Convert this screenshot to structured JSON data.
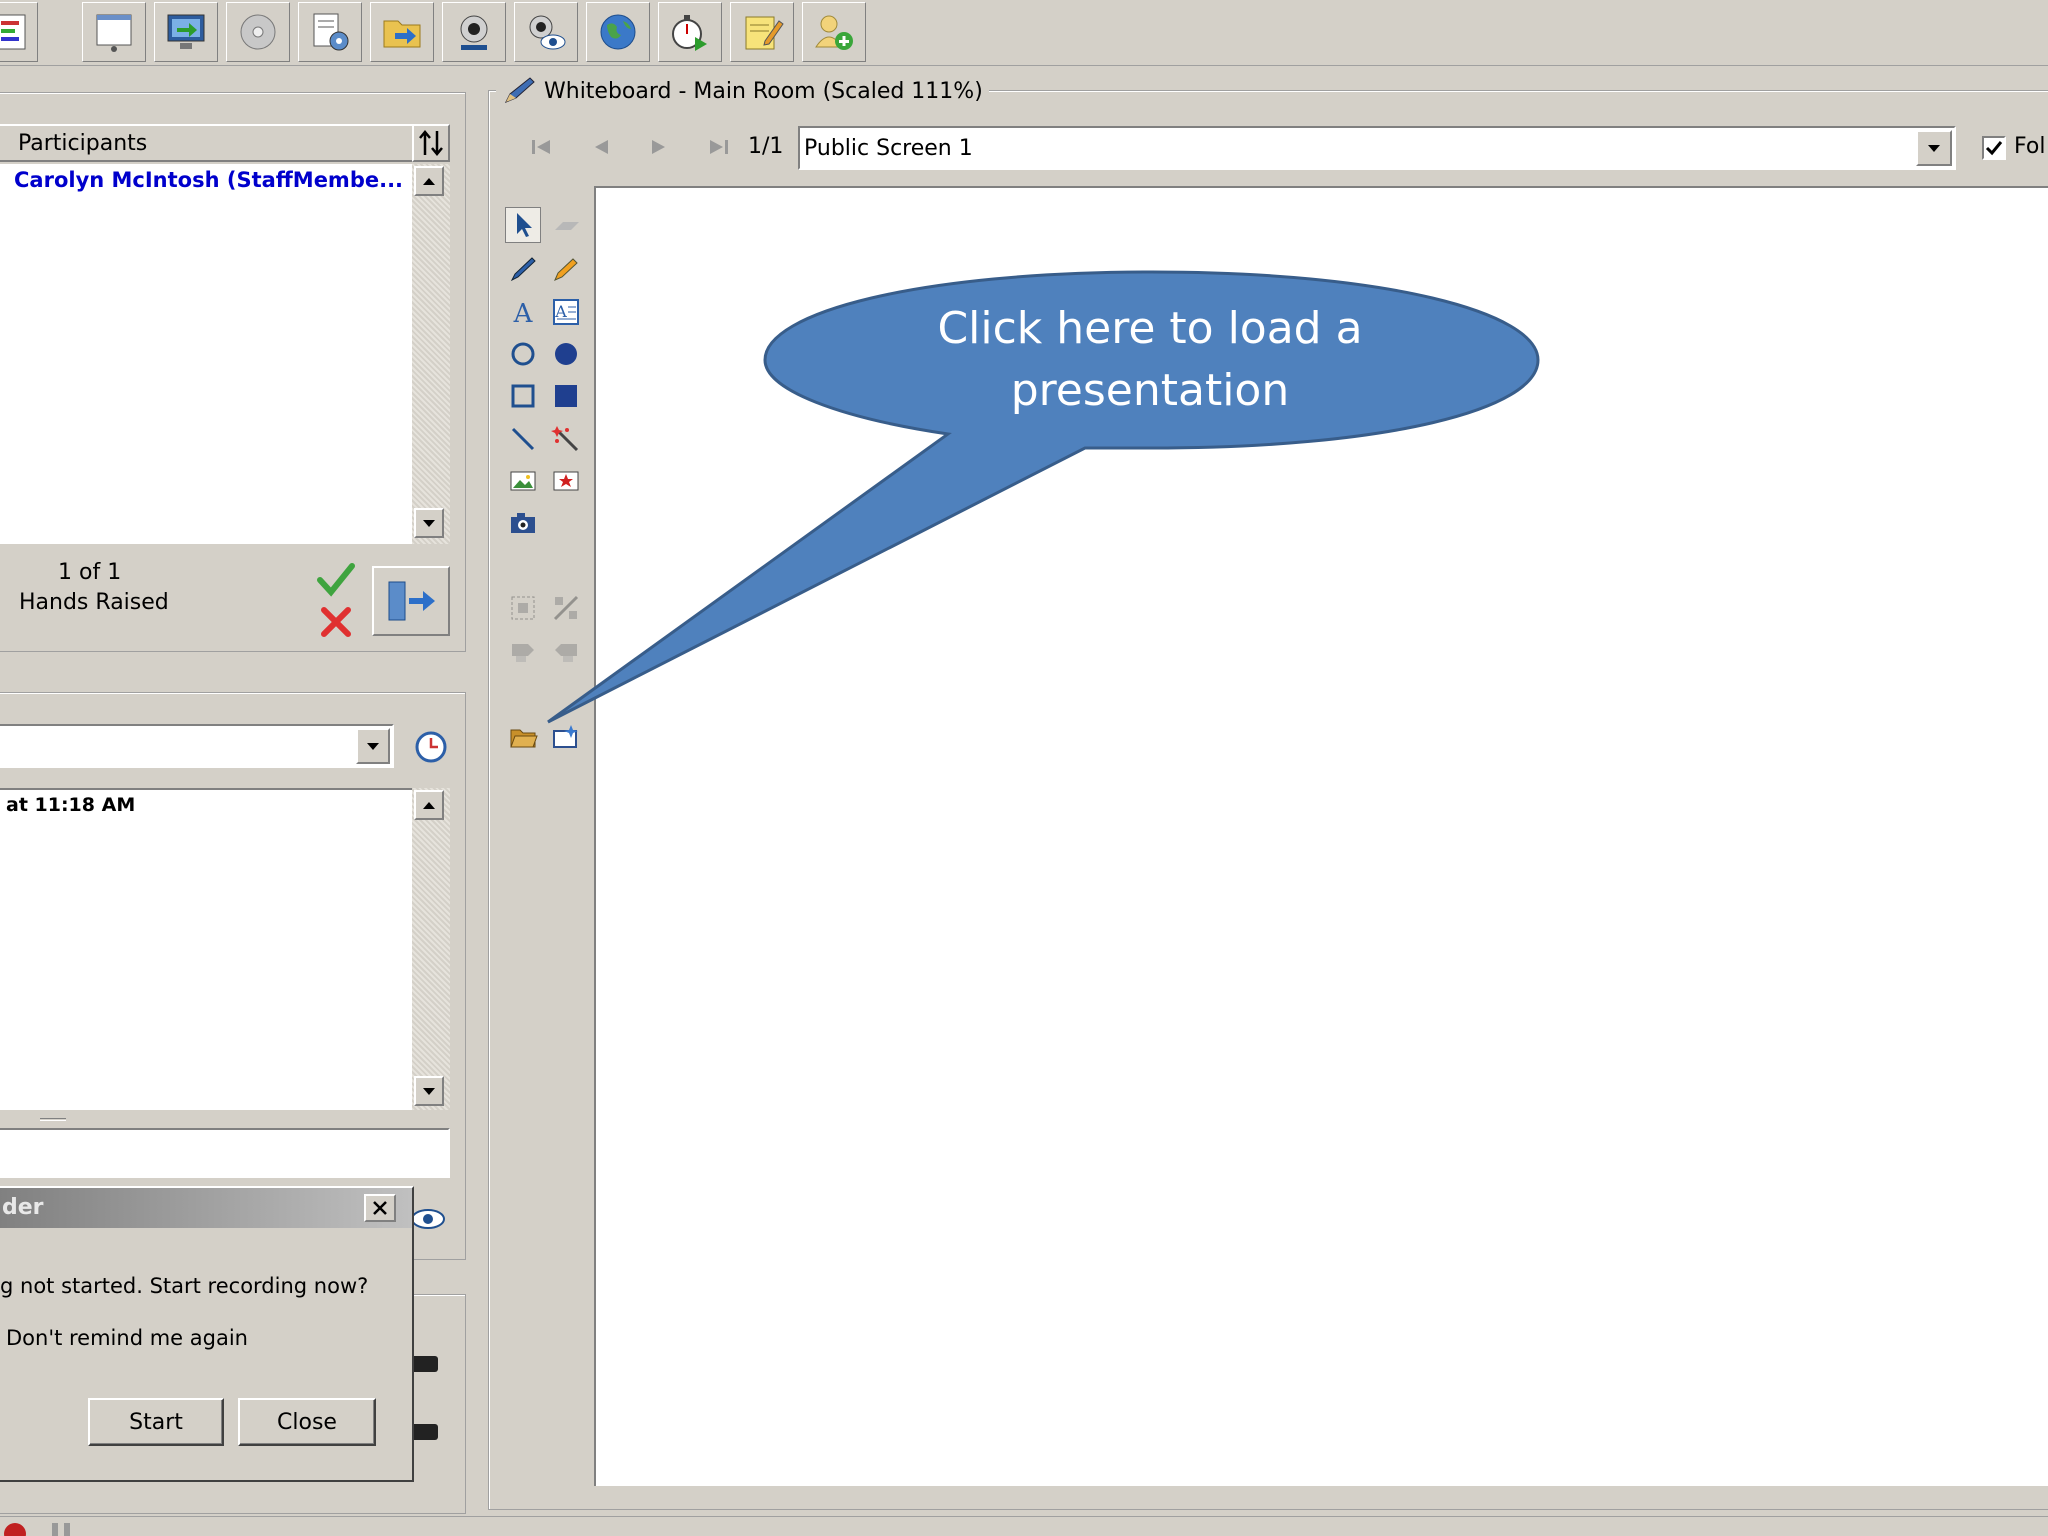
{
  "toolbar": {
    "buttons": [
      {
        "name": "agenda-icon"
      },
      {
        "name": "whiteboard-window-icon"
      },
      {
        "name": "application-share-icon"
      },
      {
        "name": "cd-media-icon"
      },
      {
        "name": "settings-document-icon"
      },
      {
        "name": "export-folder-icon"
      },
      {
        "name": "webcam-icon"
      },
      {
        "name": "webcam-view-icon"
      },
      {
        "name": "web-tour-globe-icon"
      },
      {
        "name": "timer-icon"
      },
      {
        "name": "notes-icon"
      },
      {
        "name": "add-user-icon"
      }
    ]
  },
  "participants": {
    "header": "Participants",
    "items": [
      "Carolyn McIntosh (StaffMembe..."
    ],
    "hands_count": "1 of 1",
    "hands_label": "Hands Raised"
  },
  "chat": {
    "message_line": "at 11:18 AM"
  },
  "recorder_dialog": {
    "title": "der",
    "message": "g not started. Start recording now?",
    "checkbox_label": "Don't remind me again",
    "start_label": "Start",
    "close_label": "Close"
  },
  "whiteboard": {
    "title": "Whiteboard - Main Room (Scaled 111%)",
    "page_indicator": "1/1",
    "screen_select_value": "Public Screen 1",
    "follow_label": "Fol"
  },
  "callout": {
    "text": "Click here to load a presentation"
  },
  "colors": {
    "chrome": "#d4d0c8",
    "participant_blue": "#0000cc",
    "callout_fill": "#4f81bd",
    "callout_stroke": "#385d8a"
  }
}
